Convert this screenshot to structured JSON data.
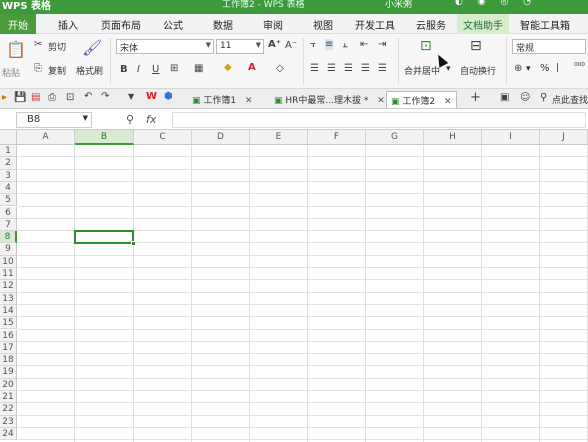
{
  "titlebar": {
    "app_name": "WPS 表格",
    "doc_title": "工作簿2 - WPS 表格",
    "user": "小米粥",
    "icons": "◐ ◉ ◎ ◔"
  },
  "menu": [
    "开始",
    "插入",
    "页面布局",
    "公式",
    "数据",
    "审阅",
    "视图",
    "开发工具",
    "云服务",
    "文档助手",
    "智能工具箱"
  ],
  "ribbon": {
    "paste": "粘贴",
    "cut": "剪切",
    "copy": "复制",
    "format_painter": "格式刷",
    "font_name": "宋体",
    "font_size": "11",
    "merge_center": "合并居中",
    "wrap_text": "自动换行",
    "number_format": "常规",
    "percent": "%",
    "comma": "⁰⁰⁰"
  },
  "tabs": [
    {
      "label": "工作簿1",
      "active": false
    },
    {
      "label": "HR中最常...理木拔 *",
      "active": false
    },
    {
      "label": "工作簿2",
      "active": true
    }
  ],
  "tabbar": {
    "add": "+",
    "search": "点此查找"
  },
  "formula": {
    "cell_ref": "B8",
    "fx": "fx",
    "content": ""
  },
  "grid": {
    "columns": [
      "A",
      "B",
      "C",
      "D",
      "E",
      "F",
      "G",
      "H",
      "I",
      "J"
    ],
    "selected_column": "B",
    "rows": [
      "1",
      "2",
      "3",
      "4",
      "5",
      "6",
      "7",
      "8",
      "9",
      "10",
      "11",
      "12",
      "13",
      "14",
      "15",
      "16",
      "17",
      "18",
      "19",
      "20",
      "21",
      "22",
      "23",
      "24"
    ],
    "selected_row": "8",
    "active_cell": "B8"
  },
  "colors": {
    "accent": "#3c9a3a",
    "selection": "#2e8b2e"
  }
}
